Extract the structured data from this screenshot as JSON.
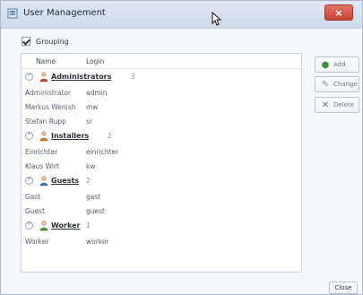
{
  "window": {
    "title": "User Management"
  },
  "grouping": {
    "label": "Grouping",
    "checked": true
  },
  "list": {
    "headers": {
      "name": "Name",
      "login": "Login"
    },
    "groups": [
      {
        "label": "Administrators",
        "count": "3",
        "users": [
          {
            "name": "Administrator",
            "login": "admin"
          },
          {
            "name": "Markus Wenish",
            "login": "mw"
          },
          {
            "name": "Stefan Rupp",
            "login": "sr"
          }
        ]
      },
      {
        "label": "Installers",
        "count": "2",
        "users": [
          {
            "name": "Einrichter",
            "login": "einrichter"
          },
          {
            "name": "Klaus Wirt",
            "login": "kw"
          }
        ]
      },
      {
        "label": "Guests",
        "count": "2",
        "users": [
          {
            "name": "Gast",
            "login": "gast"
          },
          {
            "name": "Guest",
            "login": "guest"
          }
        ]
      },
      {
        "label": "Worker",
        "count": "1",
        "users": [
          {
            "name": "Worker",
            "login": "worker"
          }
        ]
      }
    ]
  },
  "buttons": {
    "add": "Add",
    "change": "Change",
    "delete": "Delete",
    "close": "Close"
  }
}
